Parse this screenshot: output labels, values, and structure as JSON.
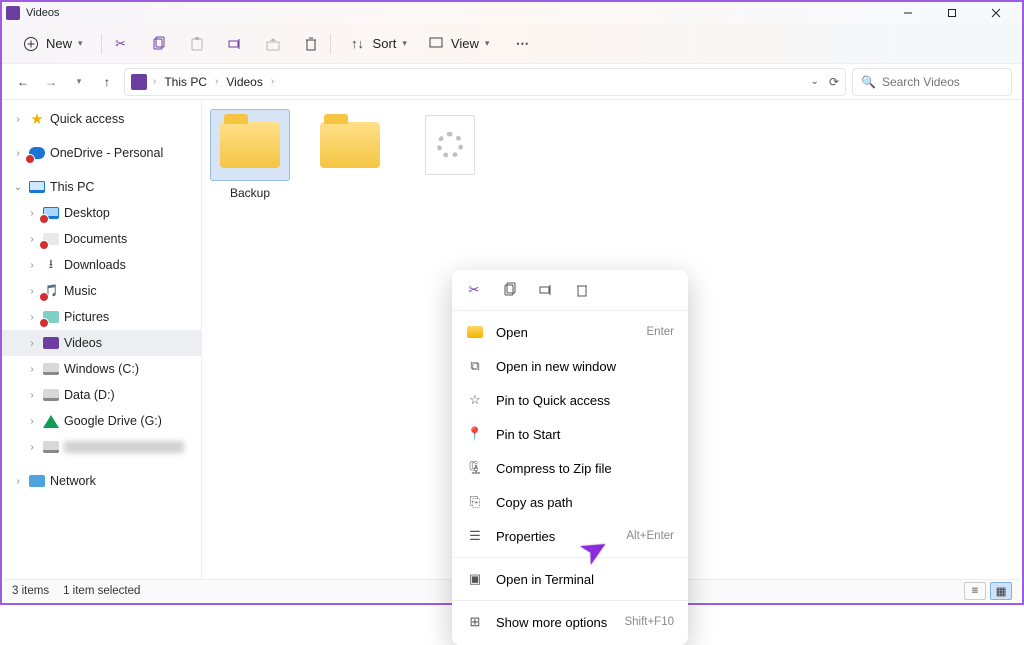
{
  "window": {
    "title": "Videos"
  },
  "toolbar": {
    "new_label": "New",
    "sort_label": "Sort",
    "view_label": "View"
  },
  "breadcrumb": {
    "root": "This PC",
    "current": "Videos"
  },
  "search": {
    "placeholder": "Search Videos"
  },
  "sidebar": {
    "quick_access": "Quick access",
    "onedrive": "OneDrive - Personal",
    "this_pc": "This PC",
    "desktop": "Desktop",
    "documents": "Documents",
    "downloads": "Downloads",
    "music": "Music",
    "pictures": "Pictures",
    "videos": "Videos",
    "windows_c": "Windows (C:)",
    "data_d": "Data (D:)",
    "google_drive": "Google Drive (G:)",
    "network": "Network"
  },
  "items": {
    "backup": "Backup"
  },
  "context_menu": {
    "open": "Open",
    "open_kbd": "Enter",
    "open_new": "Open in new window",
    "pin_quick": "Pin to Quick access",
    "pin_start": "Pin to Start",
    "compress": "Compress to Zip file",
    "copy_path": "Copy as path",
    "properties": "Properties",
    "properties_kbd": "Alt+Enter",
    "terminal": "Open in Terminal",
    "more": "Show more options",
    "more_kbd": "Shift+F10"
  },
  "status": {
    "count": "3 items",
    "selected": "1 item selected"
  }
}
